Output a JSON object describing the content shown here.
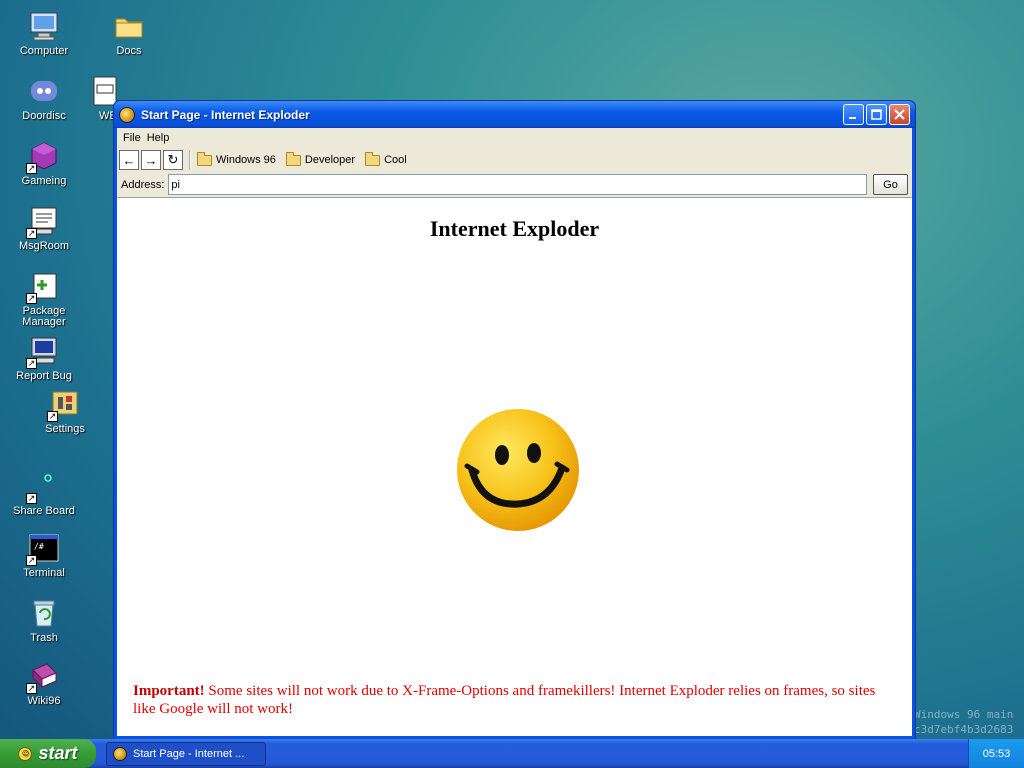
{
  "desktop": {
    "icons": [
      {
        "label": "Computer",
        "icon": "computer-icon"
      },
      {
        "label": "Docs",
        "icon": "folder-icon"
      },
      {
        "label": "Doordisc",
        "icon": "discord-icon"
      },
      {
        "label": "WE",
        "icon": "document-icon"
      },
      {
        "label": "Gameing",
        "icon": "game-cube-icon"
      },
      {
        "label": "MsgRoom",
        "icon": "chat-icon"
      },
      {
        "label": "Package Manager",
        "icon": "package-icon"
      },
      {
        "label": "Report Bug",
        "icon": "monitor-bug-icon"
      },
      {
        "label": "Settings",
        "icon": "settings-icon"
      },
      {
        "label": "Share Board",
        "icon": "share-board-icon"
      },
      {
        "label": "Terminal",
        "icon": "terminal-icon"
      },
      {
        "label": "Trash",
        "icon": "recycle-bin-icon"
      },
      {
        "label": "Wiki96",
        "icon": "book-icon"
      }
    ]
  },
  "window": {
    "title": "Start Page - Internet Exploder",
    "menu": [
      "File",
      "Help"
    ],
    "nav_buttons": {
      "back": "←",
      "forward": "→",
      "refresh": "↻"
    },
    "favorites": [
      "Windows 96",
      "Developer",
      "Cool"
    ],
    "address_label": "Address:",
    "address_value": "pi",
    "go_label": "Go",
    "page": {
      "heading": "Internet Exploder",
      "notice_strong": "Important!",
      "notice_text": " Some sites will not work due to X-Frame-Options and framekillers! Internet Exploder relies on frames, so sites like Google will not work!"
    }
  },
  "watermark": {
    "line1": "Windows 96 main",
    "line2": "c3d7ebf4b3d2683"
  },
  "taskbar": {
    "start_label": "start",
    "task_label": "Start Page - Internet ...",
    "clock": "05:53"
  },
  "colors": {
    "notice": "#e00000",
    "titlebar": "#0a5ae8",
    "start": "#379d37"
  }
}
